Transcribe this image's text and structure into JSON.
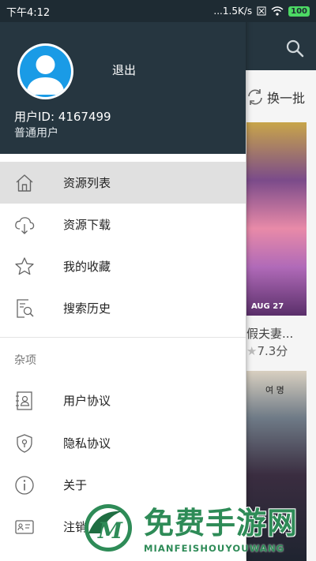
{
  "status_bar": {
    "time": "下午4:12",
    "network_speed": "...1.5K/s",
    "battery": "100"
  },
  "background": {
    "refresh_label": "换一批",
    "poster1_date": "AUG 27",
    "item1_title": "假夫妻...",
    "item1_score": "7.3分",
    "poster2_text": "여 명"
  },
  "drawer": {
    "logout_label": "退出",
    "user_id": "用户ID: 4167499",
    "user_type": "普通用户",
    "menu": [
      {
        "label": "资源列表",
        "icon": "home-icon",
        "active": true
      },
      {
        "label": "资源下载",
        "icon": "cloud-download-icon",
        "active": false
      },
      {
        "label": "我的收藏",
        "icon": "star-icon",
        "active": false
      },
      {
        "label": "搜索历史",
        "icon": "search-history-icon",
        "active": false
      }
    ],
    "section_label": "杂项",
    "misc_menu": [
      {
        "label": "用户协议",
        "icon": "user-agreement-icon"
      },
      {
        "label": "隐私协议",
        "icon": "privacy-shield-icon"
      },
      {
        "label": "关于",
        "icon": "info-icon"
      },
      {
        "label": "注销",
        "icon": "id-card-icon"
      }
    ]
  },
  "watermark": {
    "cn": "免费手游网",
    "en": "MIANFEISHOUYOUWANG"
  },
  "colors": {
    "header_bg": "#263640",
    "active_row": "#e0e0e0",
    "avatar_blue": "#1a9be6",
    "watermark_green": "#2e8b57"
  }
}
